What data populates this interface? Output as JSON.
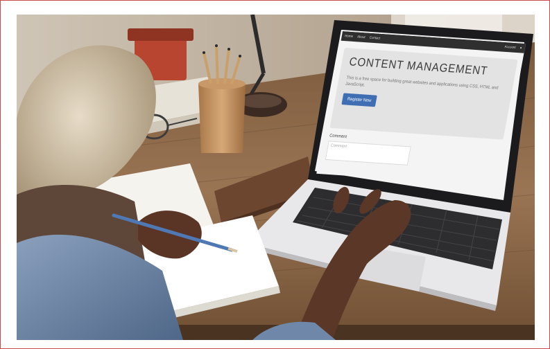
{
  "photo": {
    "subject": "person typing on a laptop at a wooden desk"
  },
  "screen": {
    "nav_items": [
      "Home",
      "About",
      "Contact"
    ],
    "nav_right": [
      "Account"
    ],
    "nav_right_icon": "user-icon",
    "headline": "CONTENT MANAGEMENT",
    "lead": "This is a free space for building great websites and applications using CSS, HTML and JavaScript.",
    "button_label": "Register Now",
    "comment_label": "Comment",
    "comment_placeholder": "Comment"
  },
  "colors": {
    "frame_border": "#c94a4a",
    "desk_wood": "#8a6a4a",
    "laptop_body": "#e8e8ea",
    "bezel": "#1b1b1d",
    "sleeve": "#6d86a6",
    "button": "#3f6eb3"
  }
}
